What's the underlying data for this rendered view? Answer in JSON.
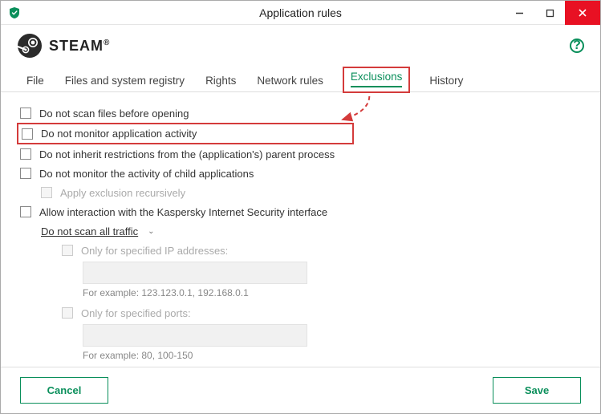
{
  "window": {
    "title": "Application rules"
  },
  "app": {
    "brand": "STEAM",
    "brand_tm": "®"
  },
  "tabs": {
    "file": "File",
    "registry": "Files and system registry",
    "rights": "Rights",
    "network": "Network rules",
    "exclusions": "Exclusions",
    "history": "History"
  },
  "exclusions": {
    "no_scan_before_open": "Do not scan files before opening",
    "no_monitor_activity": "Do not monitor application activity",
    "no_inherit_restrictions": "Do not inherit restrictions from the (application's) parent process",
    "no_monitor_child": "Do not monitor the activity of child applications",
    "apply_recursively": "Apply exclusion recursively",
    "allow_kis_interaction": "Allow interaction with the Kaspersky Internet Security interface",
    "do_not_scan_all_traffic": "Do not scan all traffic",
    "only_ip": "Only for specified IP addresses:",
    "ip_hint": "For example: 123.123.0.1, 192.168.0.1",
    "only_ports": "Only for specified ports:",
    "ports_hint": "For example: 80, 100-150"
  },
  "buttons": {
    "cancel": "Cancel",
    "save": "Save"
  }
}
